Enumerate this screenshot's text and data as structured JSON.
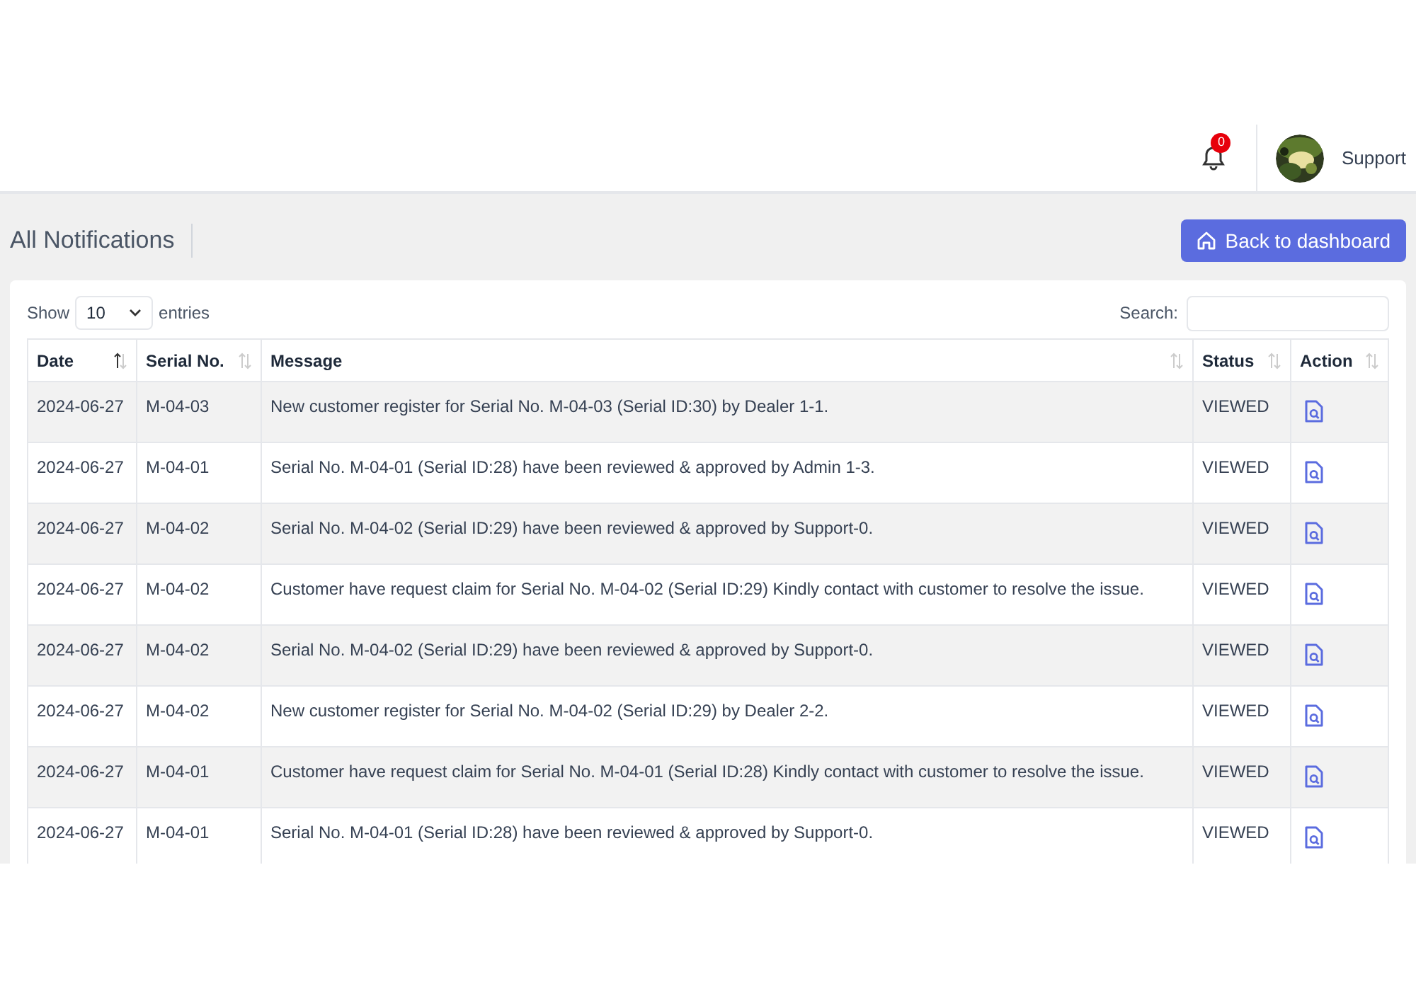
{
  "header": {
    "notification_count": "0",
    "user_name": "Support"
  },
  "page": {
    "title": "All Notifications",
    "back_button": "Back to dashboard"
  },
  "table_controls": {
    "show_label": "Show",
    "page_size": "10",
    "entries_label": "entries",
    "search_label": "Search:"
  },
  "table": {
    "columns": [
      {
        "label": "Date",
        "sorted": true
      },
      {
        "label": "Serial No.",
        "sorted": false
      },
      {
        "label": "Message",
        "sorted": false
      },
      {
        "label": "Status",
        "sorted": false
      },
      {
        "label": "Action",
        "sorted": false
      }
    ],
    "rows": [
      {
        "date": "2024-06-27",
        "serial": "M-04-03",
        "message": "New customer register for Serial No. M-04-03 (Serial ID:30) by Dealer 1-1.",
        "status": "VIEWED"
      },
      {
        "date": "2024-06-27",
        "serial": "M-04-01",
        "message": "Serial No. M-04-01 (Serial ID:28) have been reviewed & approved by Admin 1-3.",
        "status": "VIEWED"
      },
      {
        "date": "2024-06-27",
        "serial": "M-04-02",
        "message": "Serial No. M-04-02 (Serial ID:29) have been reviewed & approved by Support-0.",
        "status": "VIEWED"
      },
      {
        "date": "2024-06-27",
        "serial": "M-04-02",
        "message": "Customer have request claim for Serial No. M-04-02 (Serial ID:29) Kindly contact with customer to resolve the issue.",
        "status": "VIEWED"
      },
      {
        "date": "2024-06-27",
        "serial": "M-04-02",
        "message": "Serial No. M-04-02 (Serial ID:29) have been reviewed & approved by Support-0.",
        "status": "VIEWED"
      },
      {
        "date": "2024-06-27",
        "serial": "M-04-02",
        "message": "New customer register for Serial No. M-04-02 (Serial ID:29) by Dealer 2-2.",
        "status": "VIEWED"
      },
      {
        "date": "2024-06-27",
        "serial": "M-04-01",
        "message": "Customer have request claim for Serial No. M-04-01 (Serial ID:28) Kindly contact with customer to resolve the issue.",
        "status": "VIEWED"
      },
      {
        "date": "2024-06-27",
        "serial": "M-04-01",
        "message": "Serial No. M-04-01 (Serial ID:28) have been reviewed & approved by Support-0.",
        "status": "VIEWED"
      }
    ]
  }
}
